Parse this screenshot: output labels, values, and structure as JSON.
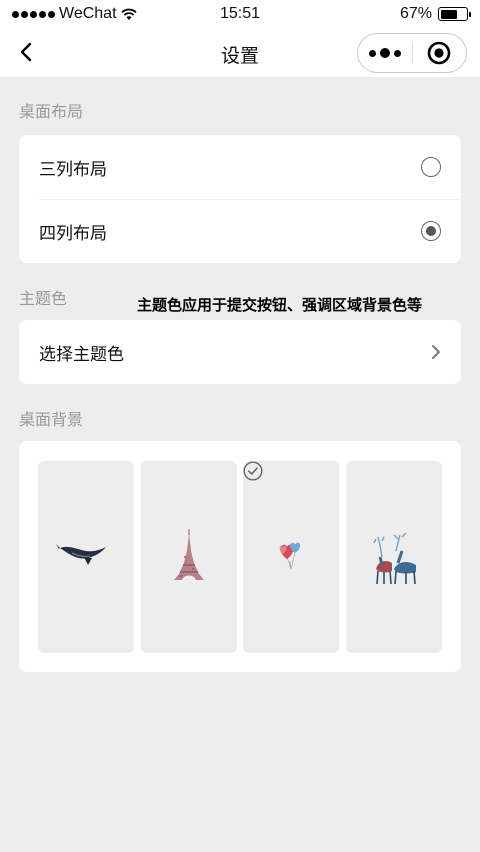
{
  "status_bar": {
    "carrier": "WeChat",
    "time": "15:51",
    "battery": "67%",
    "battery_level": 0.67
  },
  "nav": {
    "title": "设置"
  },
  "layout_section": {
    "title": "桌面布局",
    "options": [
      {
        "label": "三列布局",
        "selected": false
      },
      {
        "label": "四列布局",
        "selected": true
      }
    ]
  },
  "theme_section": {
    "title": "主题色",
    "hint": "主题色应用于提交按钮、强调区域背景色等",
    "choose_label": "选择主题色"
  },
  "background_section": {
    "title": "桌面背景",
    "items": [
      {
        "name": "whale",
        "selected": false
      },
      {
        "name": "eiffel-tower",
        "selected": false
      },
      {
        "name": "heart-balloons",
        "selected": true
      },
      {
        "name": "deer",
        "selected": false
      }
    ]
  },
  "colors": {
    "page_bg": "#ededed",
    "card_bg": "#ffffff",
    "section_title": "#999999"
  }
}
